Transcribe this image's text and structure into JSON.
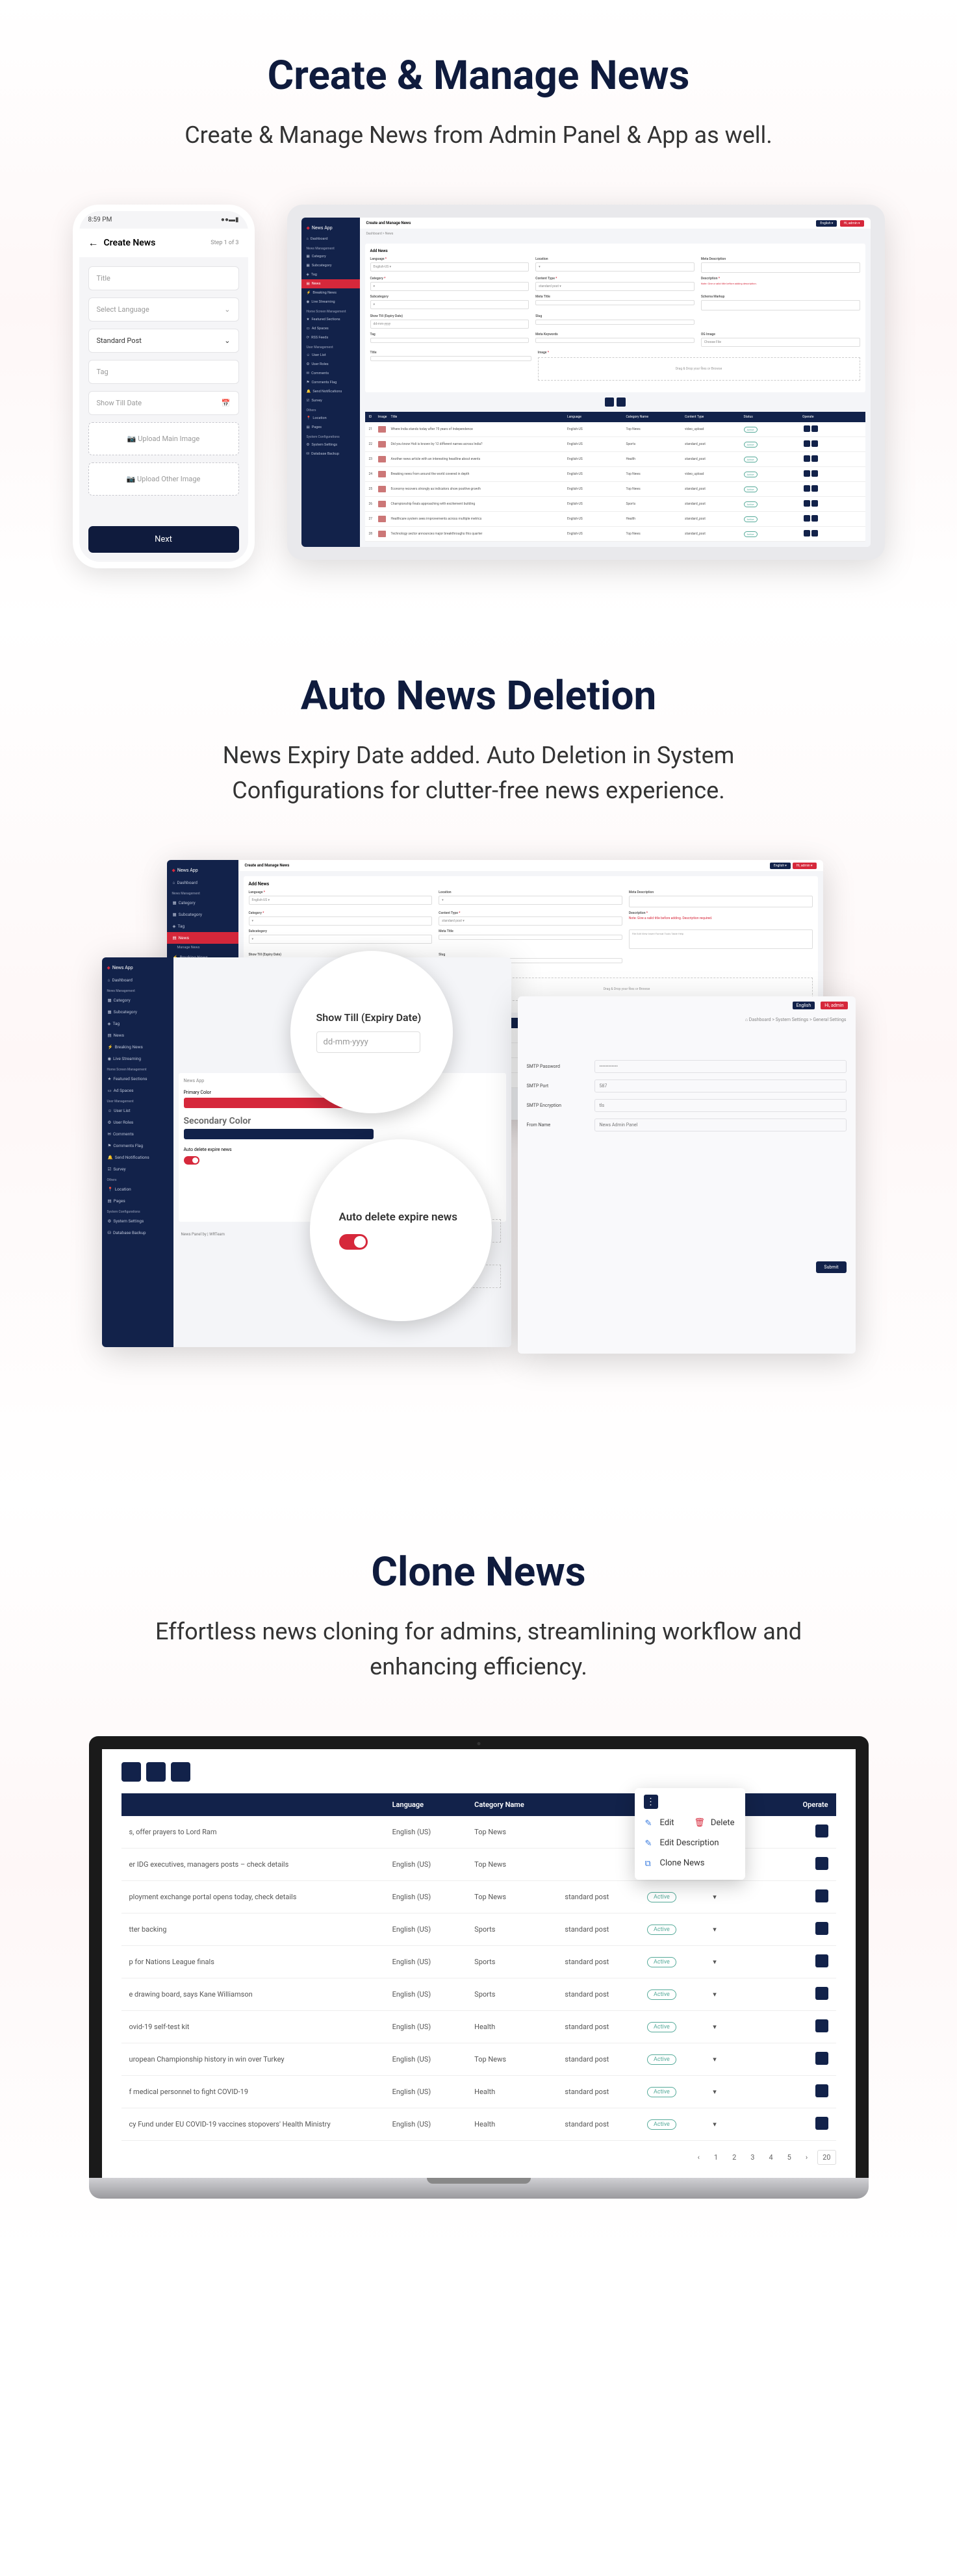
{
  "s1": {
    "title": "Create & Manage News",
    "sub": "Create & Manage News from Admin Panel & App as well.",
    "phone": {
      "time": "8:59 PM",
      "header": "Create News",
      "step": "Step 1 of 3",
      "fields": {
        "title": "Title",
        "lang": "Select Language",
        "post": "Standard Post",
        "tag": "Tag",
        "show": "Show Till Date"
      },
      "upload1": "Upload Main Image",
      "upload2": "Upload Other Image",
      "btn": "Next"
    },
    "tablet": {
      "logo": "News App",
      "page": "Create and Manage News",
      "crumb": "Dashboard > News",
      "add": "Add News",
      "labels": {
        "lang": "Language",
        "cat": "Category",
        "sub": "Subcategory",
        "tag": "Tag",
        "title": "Title",
        "show": "Show Till (Expiry Date)",
        "loc": "Location",
        "ctype": "Content Type",
        "meta": "Meta Title",
        "desc": "Description",
        "slug": "Slug",
        "key": "Meta Keywords",
        "metad": "Meta Description",
        "img": "Image",
        "schema": "Schema Markup",
        "ogimg": "OG Image"
      },
      "drop": "Drag & Drop your files or Browse",
      "cols": [
        "ID",
        "Image",
        "Title",
        "Language",
        "Category Name",
        "Content Type",
        "Status",
        "Operate"
      ],
      "rows": [
        {
          "id": "21",
          "t": "Where India stands today after 75 years of Independence",
          "l": "English-US",
          "c": "Top News",
          "ct": "video_upload",
          "s": "Active"
        },
        {
          "id": "22",
          "t": "Did you know Holi is known by 12 different names across India?",
          "l": "English-US",
          "c": "Sports",
          "ct": "standard_post",
          "s": "Active"
        },
        {
          "id": "23",
          "t": "Another news article with an interesting headline about events",
          "l": "English-US",
          "c": "Health",
          "ct": "standard_post",
          "s": "Active"
        },
        {
          "id": "24",
          "t": "Breaking news from around the world covered in depth",
          "l": "English-US",
          "c": "Top News",
          "ct": "video_upload",
          "s": "Active"
        },
        {
          "id": "25",
          "t": "Economy recovers strongly as indicators show positive growth",
          "l": "English-US",
          "c": "Top News",
          "ct": "standard_post",
          "s": "Active"
        },
        {
          "id": "26",
          "t": "Championship finals approaching with excitement building",
          "l": "English-US",
          "c": "Sports",
          "ct": "standard_post",
          "s": "Active"
        },
        {
          "id": "27",
          "t": "Healthcare system sees improvements across multiple metrics",
          "l": "English-US",
          "c": "Health",
          "ct": "standard_post",
          "s": "Active"
        },
        {
          "id": "28",
          "t": "Technology sector announces major breakthroughs this quarter",
          "l": "English-US",
          "c": "Top News",
          "ct": "standard_post",
          "s": "Active"
        }
      ],
      "side": {
        "dash": "Dashboard",
        "nmHead": "News Management",
        "cat": "Category",
        "subcat": "Subcategory",
        "tag": "Tag",
        "news": "News",
        "brk": "Breaking News",
        "live": "Live Streaming",
        "hsHead": "Home Screen Management",
        "feat": "Featured Sections",
        "ad": "Ad Spaces",
        "rss": "RSS Feeds",
        "umHead": "User Management",
        "ul": "User List",
        "ur": "User Roles",
        "com": "Comments",
        "cf": "Comments Flag",
        "sn": "Send Notifications",
        "sv": "Survey",
        "oHead": "Others",
        "loc": "Location",
        "pg": "Pages",
        "scHead": "System Configurations",
        "ss": "System Settings",
        "db": "Database Backup"
      }
    }
  },
  "s2": {
    "title": "Auto News Deletion",
    "sub": "News Expiry Date added. Auto Deletion in System Configurations for clutter-free news experience.",
    "bubble1": {
      "label": "Show Till (Expiry Date)",
      "placeholder": "dd-mm-yyyy"
    },
    "bubble2": {
      "label": "Auto delete expire news"
    },
    "panelB": {
      "secColor": "Secondary Color",
      "primColor": "Primary Color",
      "autoDel": "Auto delete expire news",
      "newsApp": "News App",
      "footer": "News Panel by | WRTeam"
    },
    "panelC": {
      "crumb": "Dashboard > System Settings > General Settings",
      "user": "Hi, admin",
      "eng": "English",
      "smtp_pw": "SMTP Password",
      "smtp_port": "SMTP Port",
      "smtp_port_v": "587",
      "smtp_enc": "SMTP Encryption",
      "smtp_enc_v": "tls",
      "from": "From Name",
      "from_v": "News Admin Panel",
      "submit": "Submit",
      "drop": "Drag & Drop your files or Browse"
    }
  },
  "s3": {
    "title": "Clone News",
    "sub": "Effortless news cloning for admins, streamlining workflow and enhancing efficiency.",
    "cols": [
      "",
      "Language",
      "Category Name",
      "",
      "",
      "",
      "Operate"
    ],
    "menu": {
      "edit": "Edit",
      "del": "Delete",
      "desc": "Edit Description",
      "clone": "Clone News"
    },
    "rows": [
      {
        "t": "s, offer prayers to Lord Ram",
        "l": "English (US)",
        "c": "Top News",
        "ct": "",
        "s": ""
      },
      {
        "t": "er IDG executives, managers posts – check details",
        "l": "English (US)",
        "c": "Top News",
        "ct": "",
        "s": ""
      },
      {
        "t": "ployment exchange portal opens today, check details",
        "l": "English (US)",
        "c": "Top News",
        "ct": "standard post",
        "s": "Active"
      },
      {
        "t": "tter backing",
        "l": "English (US)",
        "c": "Sports",
        "ct": "standard post",
        "s": "Active"
      },
      {
        "t": "p for Nations League finals",
        "l": "English (US)",
        "c": "Sports",
        "ct": "standard post",
        "s": "Active"
      },
      {
        "t": "e drawing board, says Kane Williamson",
        "l": "English (US)",
        "c": "Sports",
        "ct": "standard post",
        "s": "Active"
      },
      {
        "t": "ovid-19 self-test kit",
        "l": "English (US)",
        "c": "Health",
        "ct": "standard post",
        "s": "Active"
      },
      {
        "t": "uropean Championship history in win over Turkey",
        "l": "English (US)",
        "c": "Top News",
        "ct": "standard post",
        "s": "Active"
      },
      {
        "t": "f medical personnel to fight COVID-19",
        "l": "English (US)",
        "c": "Health",
        "ct": "standard post",
        "s": "Active"
      },
      {
        "t": "cy Fund under EU COVID-19 vaccines stopovers' Health Ministry",
        "l": "English (US)",
        "c": "Health",
        "ct": "standard post",
        "s": "Active"
      }
    ],
    "pager": [
      "‹",
      "1",
      "2",
      "3",
      "4",
      "5",
      "›",
      "20"
    ]
  }
}
